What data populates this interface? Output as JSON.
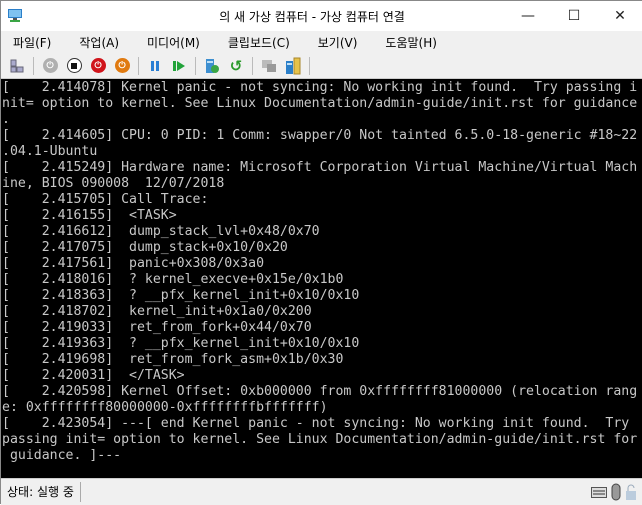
{
  "window": {
    "title": "의 새 가상 컴퓨터 - 가상 컴퓨터 연결",
    "minimize": "—",
    "maximize": "☐",
    "close": "✕"
  },
  "menu": [
    "파일(F)",
    "작업(A)",
    "미디어(M)",
    "클립보드(C)",
    "보기(V)",
    "도움말(H)"
  ],
  "toolbar": {
    "icons": [
      "layout-icon",
      "ctrl-alt-del-icon",
      "stop-icon",
      "shutdown-icon",
      "save-icon",
      "pause-icon",
      "resume-icon",
      "checkpoint-icon",
      "revert-icon",
      "enhanced-session-icon",
      "share-icon"
    ],
    "colors": {
      "shutdown": "#d0141b",
      "save": "#e07a10",
      "pause": "#2a7fd4",
      "resume": "#22a33a",
      "disabled": "#b0b0b0"
    }
  },
  "terminal": {
    "lines": [
      "[    2.414078] Kernel panic - not syncing: No working init found.  Try passing i",
      "nit= option to kernel. See Linux Documentation/admin-guide/init.rst for guidance",
      ".",
      "[    2.414605] CPU: 0 PID: 1 Comm: swapper/0 Not tainted 6.5.0-18-generic #18~22",
      ".04.1-Ubuntu",
      "[    2.415249] Hardware name: Microsoft Corporation Virtual Machine/Virtual Mach",
      "ine, BIOS 090008  12/07/2018",
      "[    2.415705] Call Trace:",
      "[    2.416155]  <TASK>",
      "[    2.416612]  dump_stack_lvl+0x48/0x70",
      "[    2.417075]  dump_stack+0x10/0x20",
      "[    2.417561]  panic+0x308/0x3a0",
      "[    2.418016]  ? kernel_execve+0x15e/0x1b0",
      "[    2.418363]  ? __pfx_kernel_init+0x10/0x10",
      "[    2.418702]  kernel_init+0x1a0/0x200",
      "[    2.419033]  ret_from_fork+0x44/0x70",
      "[    2.419363]  ? __pfx_kernel_init+0x10/0x10",
      "[    2.419698]  ret_from_fork_asm+0x1b/0x30",
      "[    2.420031]  </TASK>",
      "[    2.420598] Kernel Offset: 0xb000000 from 0xffffffff81000000 (relocation rang",
      "e: 0xffffffff80000000-0xffffffffbfffffff)",
      "[    2.423054] ---[ end Kernel panic - not syncing: No working init found.  Try",
      "passing init= option to kernel. See Linux Documentation/admin-guide/init.rst for",
      " guidance. ]---"
    ]
  },
  "status": {
    "text": "상태: 실행 중"
  }
}
